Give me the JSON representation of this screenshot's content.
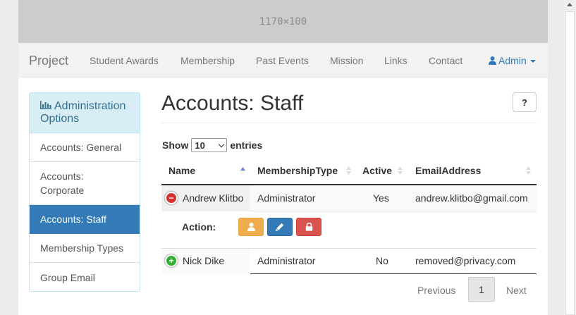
{
  "banner": {
    "text": "1170×100"
  },
  "navbar": {
    "brand": "Project",
    "links": [
      "Student Awards",
      "Membership",
      "Past Events",
      "Mission",
      "Links",
      "Contact"
    ],
    "user_menu": {
      "label": "Admin",
      "icon": "user-icon"
    }
  },
  "sidebar": {
    "title": "Administration Options",
    "title_icon": "bar-chart-icon",
    "items": [
      {
        "label": "Accounts: General",
        "active": false
      },
      {
        "label": "Accounts: Corporate",
        "active": false
      },
      {
        "label": "Accounts: Staff",
        "active": true
      },
      {
        "label": "Membership Types",
        "active": false
      },
      {
        "label": "Group Email",
        "active": false
      }
    ]
  },
  "main": {
    "title": "Accounts: Staff",
    "help_label": "?",
    "length_menu": {
      "prefix": "Show",
      "value": "10",
      "suffix": "entries"
    },
    "table": {
      "columns": [
        "Name",
        "MembershipType",
        "Active",
        "EmailAddress"
      ],
      "rows": [
        {
          "name": "Andrew Klitbo",
          "membership_type": "Administrator",
          "active": "Yes",
          "email": "andrew.klitbo@gmail.com",
          "expanded": true
        },
        {
          "name": "Nick Dike",
          "membership_type": "Administrator",
          "active": "No",
          "email": "removed@privacy.com",
          "expanded": false
        }
      ],
      "child_row": {
        "action_label": "Action:",
        "buttons": [
          {
            "icon": "user-icon",
            "color": "#f0ad4e"
          },
          {
            "icon": "pencil-icon",
            "color": "#337ab7"
          },
          {
            "icon": "lock-icon",
            "color": "#d9534f"
          }
        ]
      }
    },
    "pagination": {
      "previous": "Previous",
      "current": "1",
      "next": "Next"
    }
  },
  "colors": {
    "accent": "#337ab7",
    "sidebar_header_bg": "#d9edf7",
    "sidebar_header_text": "#31708f"
  }
}
